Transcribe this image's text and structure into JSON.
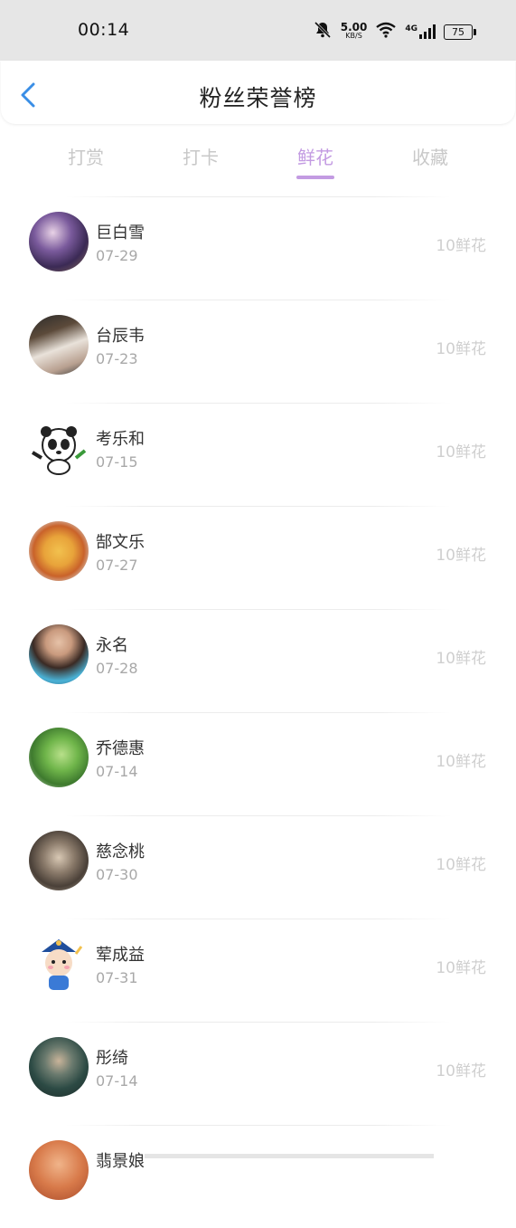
{
  "status_bar": {
    "time": "00:14",
    "net_speed_value": "5.00",
    "net_speed_unit": "KB/S",
    "network_type": "4G",
    "battery": "75"
  },
  "header": {
    "title": "粉丝荣誉榜"
  },
  "tabs": [
    {
      "label": "打赏",
      "active": false
    },
    {
      "label": "打卡",
      "active": false
    },
    {
      "label": "鲜花",
      "active": true
    },
    {
      "label": "收藏",
      "active": false
    }
  ],
  "colors": {
    "accent": "#c39be2",
    "back_arrow": "#3a8ee6",
    "inactive_tab": "#c8c8c8"
  },
  "fans": [
    {
      "name": "巨白雪",
      "date": "07-29",
      "amount": "10鲜花"
    },
    {
      "name": "台辰韦",
      "date": "07-23",
      "amount": "10鲜花"
    },
    {
      "name": "考乐和",
      "date": "07-15",
      "amount": "10鲜花"
    },
    {
      "name": "郜文乐",
      "date": "07-27",
      "amount": "10鲜花"
    },
    {
      "name": "永名",
      "date": "07-28",
      "amount": "10鲜花"
    },
    {
      "name": "乔德惠",
      "date": "07-14",
      "amount": "10鲜花"
    },
    {
      "name": "慈念桃",
      "date": "07-30",
      "amount": "10鲜花"
    },
    {
      "name": "荤成益",
      "date": "07-31",
      "amount": "10鲜花"
    },
    {
      "name": "彤绮",
      "date": "07-14",
      "amount": "10鲜花"
    },
    {
      "name": "翡景娘",
      "date": "",
      "amount": ""
    }
  ]
}
